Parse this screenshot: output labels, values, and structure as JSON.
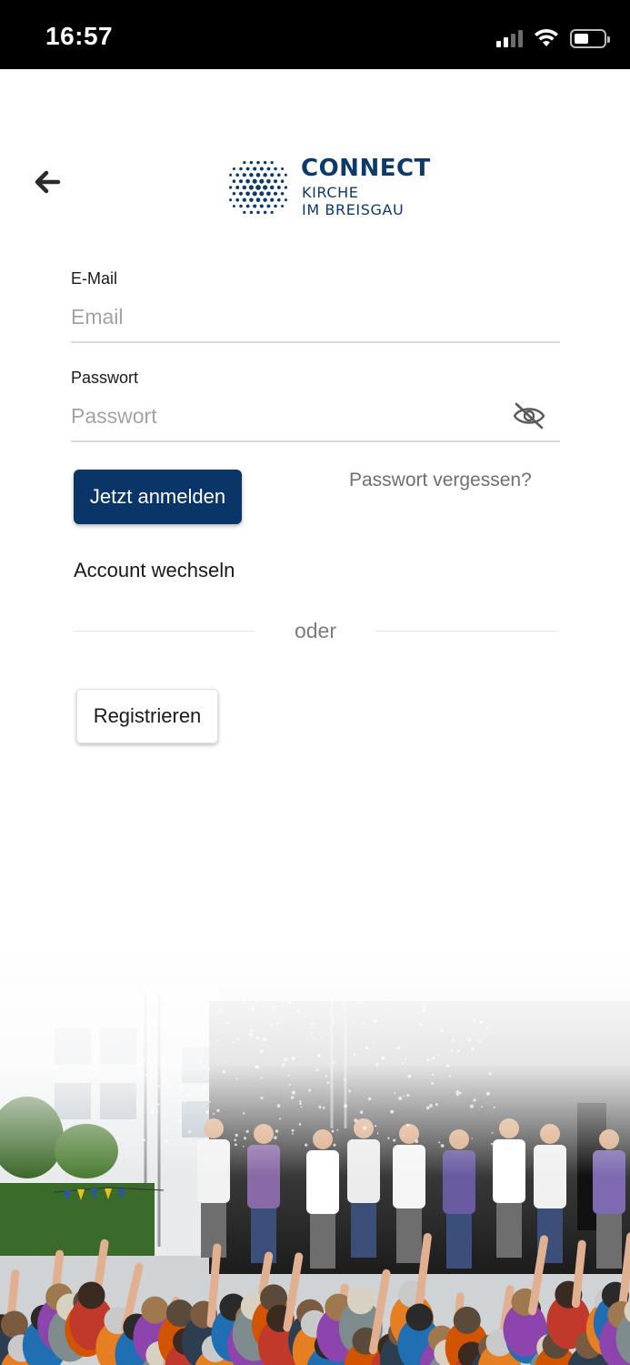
{
  "status_bar": {
    "time": "16:57"
  },
  "logo": {
    "title": "CONNECT",
    "line1": "KIRCHE",
    "line2": "IM BREISGAU",
    "color": "#0d3a6b"
  },
  "form": {
    "email_label": "E-Mail",
    "email_placeholder": "Email",
    "password_label": "Passwort",
    "password_placeholder": "Passwort",
    "login_button": "Jetzt anmelden",
    "forgot_link": "Passwort vergessen?",
    "switch_account": "Account wechseln",
    "divider_text": "oder",
    "register_button": "Registrieren"
  },
  "colors": {
    "primary": "#0a3568",
    "muted": "#6f6f6f"
  },
  "icons": {
    "back": "arrow-left-icon",
    "eye": "eye-off-icon"
  }
}
